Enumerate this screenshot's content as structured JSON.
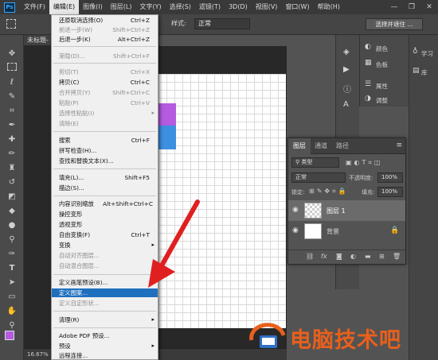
{
  "app": {
    "logo": "Ps"
  },
  "menubar": {
    "items": [
      "文件(F)",
      "编辑(E)",
      "图像(I)",
      "图层(L)",
      "文字(Y)",
      "选择(S)",
      "滤镜(T)",
      "3D(D)",
      "视图(V)",
      "窗口(W)",
      "帮助(H)"
    ],
    "active_index": 1,
    "window_controls": [
      "—",
      "❐",
      "✕"
    ]
  },
  "options": {
    "style_label": "样式:",
    "style_value": "正常",
    "select_mask": "选择并遮住 ..."
  },
  "document": {
    "tab_title": "未标题-",
    "zoom": "16.67%"
  },
  "edit_menu": {
    "items": [
      {
        "label": "还原取消选择(O)",
        "shortcut": "Ctrl+Z",
        "enabled": true
      },
      {
        "label": "前进一步(W)",
        "shortcut": "Shift+Ctrl+Z",
        "enabled": false
      },
      {
        "label": "后退一步(K)",
        "shortcut": "Alt+Ctrl+Z",
        "enabled": true
      },
      {
        "label": "渐隐(D)...",
        "shortcut": "Shift+Ctrl+F",
        "enabled": false
      },
      {
        "label": "剪切(T)",
        "shortcut": "Ctrl+X",
        "enabled": false
      },
      {
        "label": "拷贝(C)",
        "shortcut": "Ctrl+C",
        "enabled": true
      },
      {
        "label": "合并拷贝(Y)",
        "shortcut": "Shift+Ctrl+C",
        "enabled": false
      },
      {
        "label": "粘贴(P)",
        "shortcut": "Ctrl+V",
        "enabled": false
      },
      {
        "label": "选择性粘贴(I)",
        "shortcut": "",
        "enabled": false,
        "submenu": true
      },
      {
        "label": "清除(E)",
        "shortcut": "",
        "enabled": false
      },
      {
        "label": "搜索",
        "shortcut": "Ctrl+F",
        "enabled": true
      },
      {
        "label": "拼写检查(H)...",
        "shortcut": "",
        "enabled": true
      },
      {
        "label": "查找和替换文本(X)...",
        "shortcut": "",
        "enabled": true
      },
      {
        "label": "填充(L)...",
        "shortcut": "Shift+F5",
        "enabled": true
      },
      {
        "label": "描边(S)...",
        "shortcut": "",
        "enabled": true
      },
      {
        "label": "内容识别缩放",
        "shortcut": "Alt+Shift+Ctrl+C",
        "enabled": true
      },
      {
        "label": "操控变形",
        "shortcut": "",
        "enabled": true
      },
      {
        "label": "透视变形",
        "shortcut": "",
        "enabled": true
      },
      {
        "label": "自由变换(F)",
        "shortcut": "Ctrl+T",
        "enabled": true
      },
      {
        "label": "变换",
        "shortcut": "",
        "enabled": true,
        "submenu": true
      },
      {
        "label": "自动对齐图层...",
        "shortcut": "",
        "enabled": false
      },
      {
        "label": "自动混合图层...",
        "shortcut": "",
        "enabled": false
      },
      {
        "label": "定义画笔预设(B)...",
        "shortcut": "",
        "enabled": true
      },
      {
        "label": "定义图案...",
        "shortcut": "",
        "enabled": true,
        "highlighted": true
      },
      {
        "label": "定义自定形状...",
        "shortcut": "",
        "enabled": false
      },
      {
        "label": "清理(R)",
        "shortcut": "",
        "enabled": true,
        "submenu": true
      },
      {
        "label": "Adobe PDF 预设...",
        "shortcut": "",
        "enabled": true
      },
      {
        "label": "预设",
        "shortcut": "",
        "enabled": true,
        "submenu": true
      },
      {
        "label": "远程连接...",
        "shortcut": "",
        "enabled": true
      }
    ]
  },
  "right_panels": {
    "color": "颜色",
    "swatches": "色板",
    "properties": "属性",
    "adjustments": "调整",
    "learn": "学习",
    "libraries": "库"
  },
  "layers_panel": {
    "tabs": [
      "图层",
      "通道",
      "路径"
    ],
    "filter_label": "类型",
    "blend_mode": "正常",
    "opacity_label": "不透明度:",
    "opacity_value": "100%",
    "lock_label": "锁定:",
    "fill_label": "填充:",
    "fill_value": "100%",
    "layers": [
      {
        "name": "图层 1",
        "selected": true
      },
      {
        "name": "背景",
        "selected": false,
        "locked": true
      }
    ],
    "footer_icons": [
      "link-icon",
      "fx-icon",
      "mask-icon",
      "adjustment-icon",
      "folder-icon",
      "new-layer-icon",
      "trash-icon"
    ]
  },
  "watermark": {
    "text": "电脑技术吧"
  },
  "colors": {
    "menu_highlight": "#1e6fbe",
    "accent_orange": "#e8601c",
    "purple_tile": "#b55be0",
    "blue_tile": "#3d8fe0",
    "arrow_red": "#e02020"
  }
}
